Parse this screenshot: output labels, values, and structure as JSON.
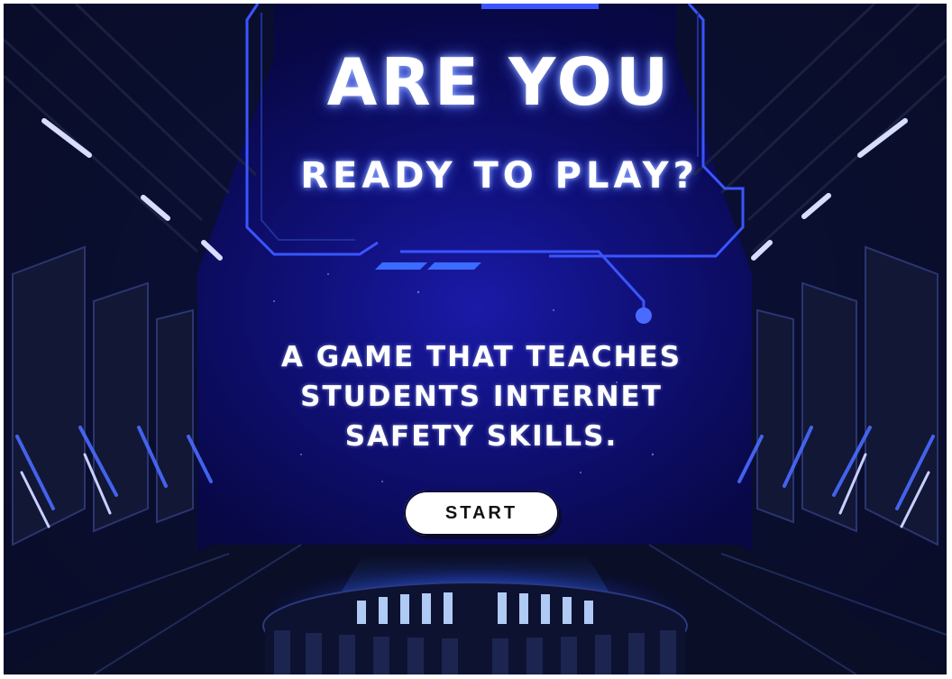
{
  "title": {
    "line1": "ARE YOU",
    "line2": "READY TO PLAY?"
  },
  "tagline": {
    "lines": [
      "A GAME THAT TEACHES",
      "STUDENTS INTERNET",
      "SAFETY SKILLS."
    ]
  },
  "start_button": {
    "label": "START"
  },
  "colors": {
    "neon": "#5a6bff",
    "glow": "#9fb6ff",
    "deep_blue": "#08084a",
    "button": "#ffffff"
  }
}
